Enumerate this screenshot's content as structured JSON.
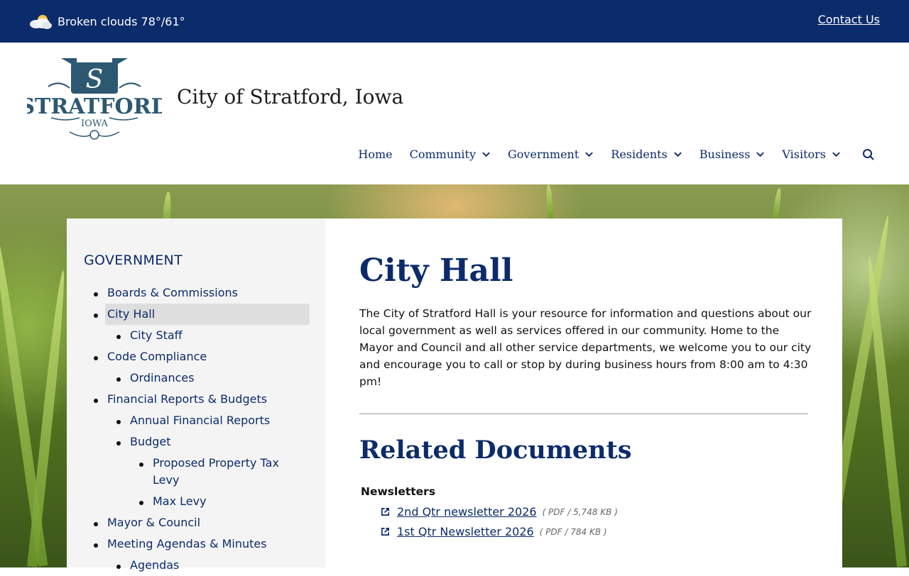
{
  "topbar": {
    "weather_text": "Broken clouds 78°/61°",
    "weather_icon": "cloud-icon",
    "contact_label": "Contact Us"
  },
  "header": {
    "logo_name": "STRATFORD",
    "logo_sub": "IOWA",
    "site_title": "City of Stratford, Iowa"
  },
  "nav": {
    "items": [
      {
        "label": "Home",
        "has_dropdown": false
      },
      {
        "label": "Community",
        "has_dropdown": true
      },
      {
        "label": "Government",
        "has_dropdown": true
      },
      {
        "label": "Residents",
        "has_dropdown": true
      },
      {
        "label": "Business",
        "has_dropdown": true
      },
      {
        "label": "Visitors",
        "has_dropdown": true
      }
    ],
    "search_icon": "search-icon"
  },
  "sidebar": {
    "title": "GOVERNMENT",
    "items": [
      {
        "label": "Boards & Commissions",
        "level": 1
      },
      {
        "label": "City Hall",
        "level": 1,
        "active": true
      },
      {
        "label": "City Staff",
        "level": 2
      },
      {
        "label": "Code Compliance",
        "level": 1
      },
      {
        "label": "Ordinances",
        "level": 2
      },
      {
        "label": "Financial Reports & Budgets",
        "level": 1
      },
      {
        "label": "Annual Financial Reports",
        "level": 2
      },
      {
        "label": "Budget",
        "level": 2
      },
      {
        "label": "Proposed Property Tax",
        "label2": "Levy",
        "level": 3
      },
      {
        "label": "Max Levy",
        "level": 3
      },
      {
        "label": "Mayor & Council",
        "level": 1
      },
      {
        "label": "Meeting Agendas & Minutes",
        "level": 1
      },
      {
        "label": "Agendas",
        "level": 2
      }
    ]
  },
  "main": {
    "title": "City Hall",
    "intro": "The City of Stratford Hall is your resource for information and questions about our local government as well as services offered in our community. Home to the Mayor and Council and all other service departments, we welcome you to our city and encourage you to call or stop by during business hours from 8:00 am to 4:30 pm!",
    "related_title": "Related Documents",
    "category": "Newsletters",
    "documents": [
      {
        "label": "2nd Qtr newsletter 2026",
        "meta": "( PDF / 5,748 KB )"
      },
      {
        "label": "1st Qtr Newsletter 2026",
        "meta": "( PDF / 784 KB )"
      }
    ]
  }
}
